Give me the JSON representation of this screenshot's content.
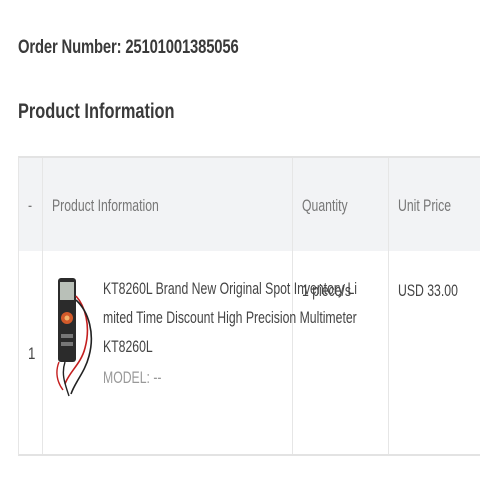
{
  "order": {
    "number_label": "Order Number: 25101001385056"
  },
  "section": {
    "title": "Product Information"
  },
  "table": {
    "headers": [
      "-",
      "Product Information",
      "Quantity",
      "Unit Price"
    ],
    "rows": [
      {
        "index": "1",
        "product_name": "KT8260L Brand New Original Spot Inventory Limited Time Discount High Precision Multimeter KT8260L",
        "model": "MODEL: --",
        "quantity": "1 piece/s",
        "unit_price": "USD 33.00",
        "image_icon": "multimeter-thumbnail"
      }
    ]
  }
}
